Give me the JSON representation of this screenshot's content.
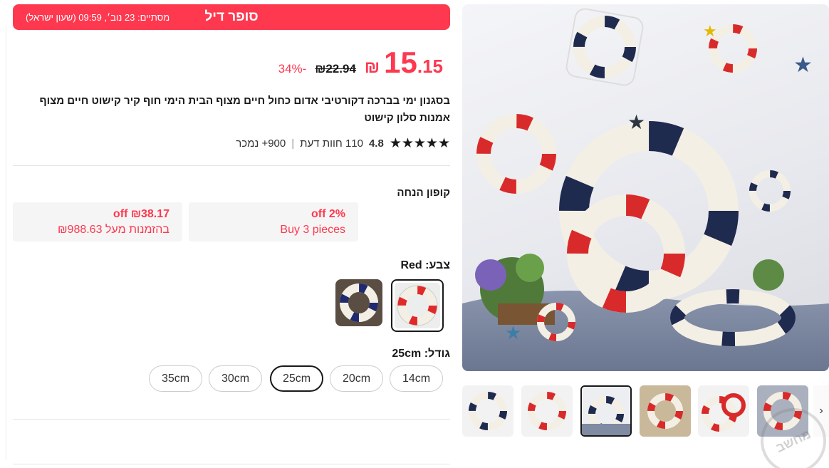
{
  "banner": {
    "title": "סופר דיל",
    "ends": "מסתיים:  23 נוב׳, 09:59 (שעון ישראל)"
  },
  "price": {
    "currency": "₪",
    "integer": "15",
    "decimal": ".15",
    "original": "₪22.94",
    "discount": "34%-"
  },
  "product": {
    "title": "בסגנון ימי בברכה דקורטיבי אדום כחול חיים מצוף הבית הימי חוף קיר קישוט חיים מצוף אמנות סלון קישוט"
  },
  "rating": {
    "stars": "★★★★★",
    "value": "4.8",
    "reviews": "110 חוות דעת",
    "separator": "|",
    "sold": "900+ נמכר"
  },
  "coupons": {
    "heading": "קופון הנחה",
    "items": [
      {
        "line1": "2% off",
        "line2": "Buy 3 pieces"
      },
      {
        "line1": "₪38.17 off",
        "line2": "בהזמנות מעל ₪988.63"
      }
    ]
  },
  "color": {
    "heading": "צבע: Red",
    "options": [
      "Red",
      "Blue"
    ],
    "selected": "Red"
  },
  "size": {
    "heading": "גודל: 25cm",
    "options": [
      "14cm",
      "20cm",
      "25cm",
      "30cm",
      "35cm"
    ],
    "selected": "25cm"
  },
  "gallery": {
    "arrow": "›",
    "thumb_count": 6,
    "selected_thumb": 2
  },
  "watermark": "מחשב",
  "colors": {
    "accent": "#fd384f",
    "navy": "#1f2a4f",
    "ring": "#f4efe4"
  }
}
